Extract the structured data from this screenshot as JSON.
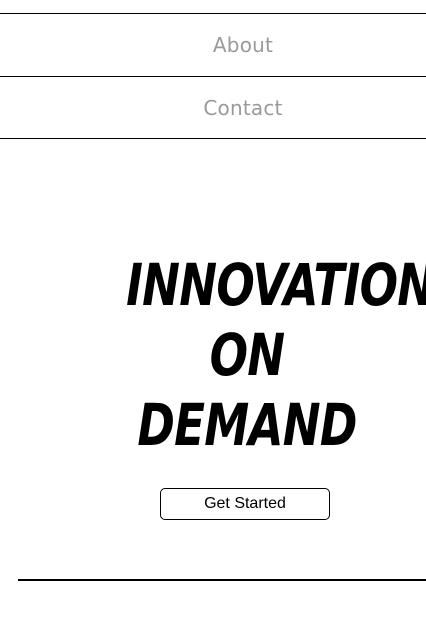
{
  "nav": {
    "items": [
      {
        "label": "About"
      },
      {
        "label": "Contact"
      }
    ]
  },
  "hero": {
    "title_lines": [
      "INNOVATION",
      "ON",
      "DEMAND"
    ],
    "cta_label": "Get Started"
  },
  "colors": {
    "nav_text": "#9a9a9a",
    "text": "#000000",
    "background": "#ffffff",
    "border": "#000000"
  }
}
